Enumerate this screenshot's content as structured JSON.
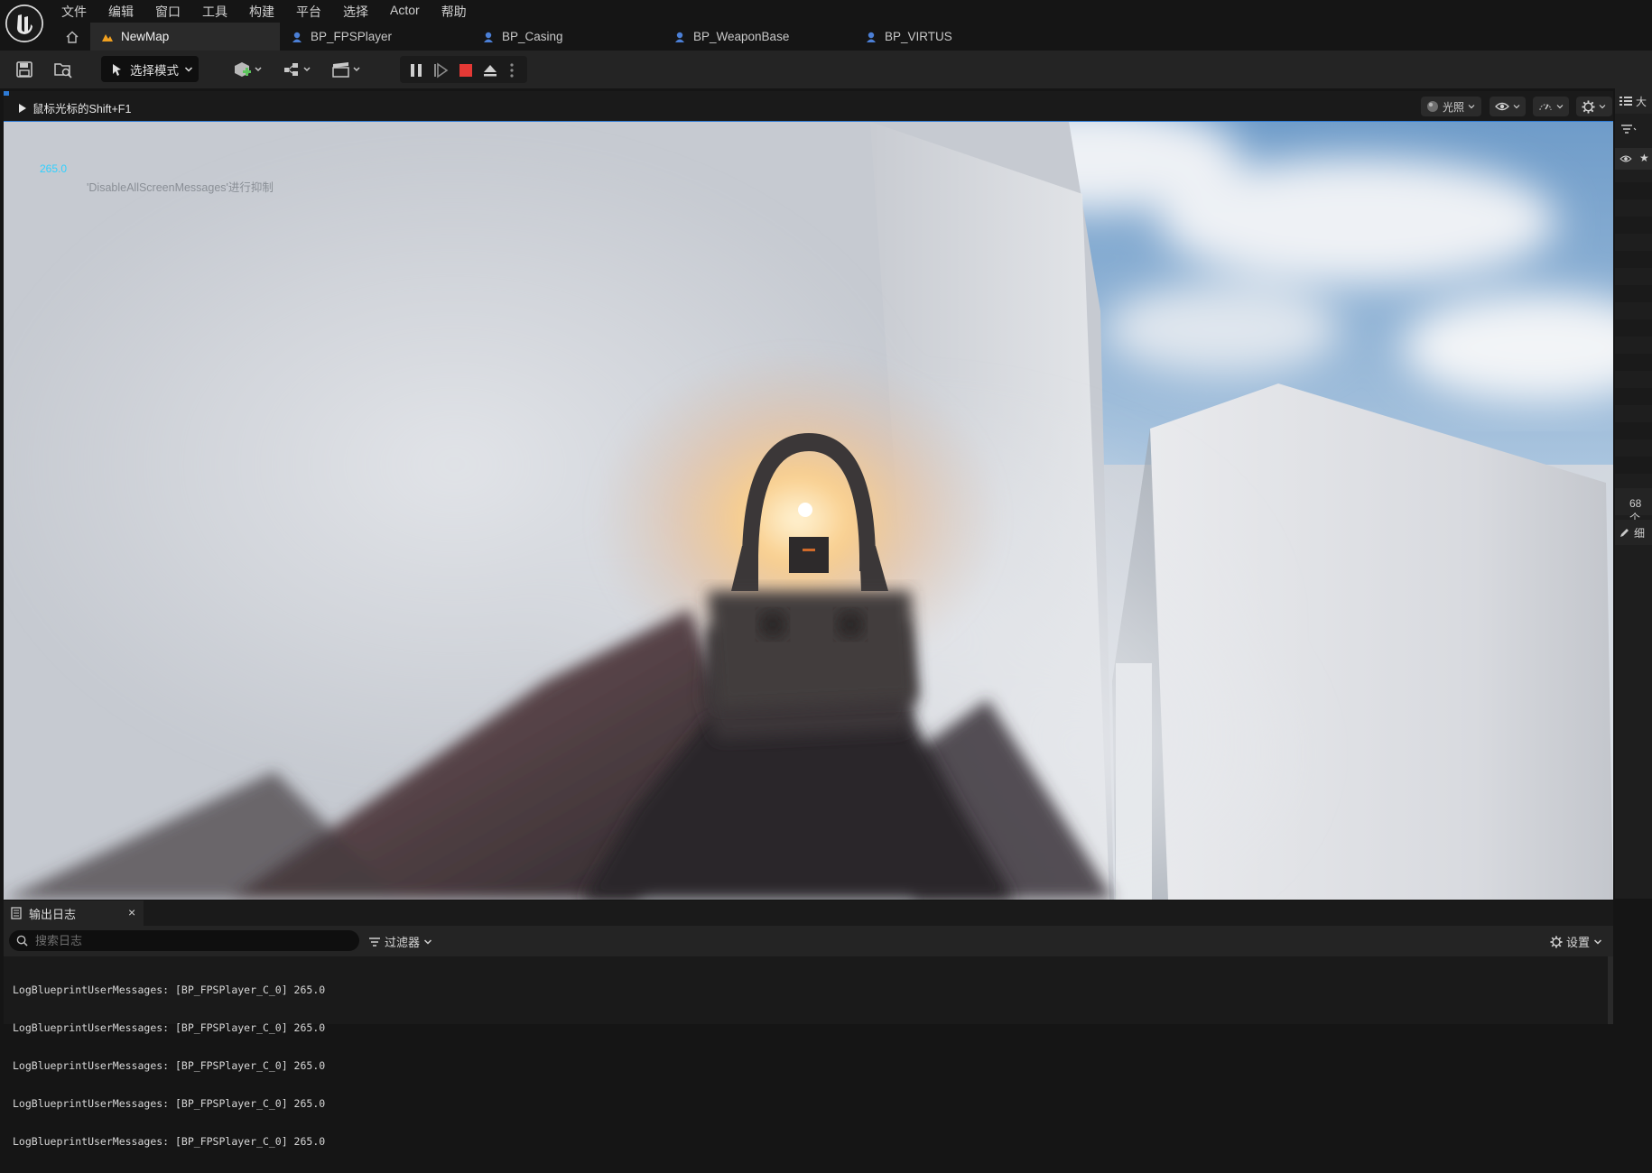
{
  "menu": [
    "文件",
    "编辑",
    "窗口",
    "工具",
    "构建",
    "平台",
    "选择",
    "Actor",
    "帮助"
  ],
  "tabs": [
    {
      "label": "NewMap",
      "icon": "level-icon",
      "active": true
    },
    {
      "label": "BP_FPSPlayer",
      "icon": "blueprint-icon",
      "active": false
    },
    {
      "label": "BP_Casing",
      "icon": "blueprint-icon",
      "active": false
    },
    {
      "label": "BP_WeaponBase",
      "icon": "blueprint-icon",
      "active": false
    },
    {
      "label": "BP_VIRTUS",
      "icon": "blueprint-icon",
      "active": false
    }
  ],
  "toolbar": {
    "mode_label": "选择模式",
    "icons": [
      "save-icon",
      "content-browser-icon",
      "add-actor-icon",
      "blueprint-menu-icon",
      "cinematics-icon",
      "pause-icon",
      "step-icon",
      "stop-icon",
      "eject-icon",
      "more-options-icon"
    ],
    "stop_color": "#e53935"
  },
  "viewport": {
    "hint_text": "鼠标光标的Shift+F1",
    "lighting_label": "光照",
    "fps_value": "265.0",
    "screen_message": "'DisableAllScreenMessages'进行抑制",
    "accent": "#2fd0ff"
  },
  "right_panel": {
    "count_text": "68个",
    "detail_char": "细",
    "outliner_char": "大"
  },
  "output_log": {
    "tab_label": "输出日志",
    "close_label": "×",
    "search_placeholder": "搜索日志",
    "filter_label": "过滤器",
    "settings_label": "设置",
    "lines": [
      "LogBlueprintUserMessages: [BP_FPSPlayer_C_0] 265.0",
      "LogBlueprintUserMessages: [BP_FPSPlayer_C_0] 265.0",
      "LogBlueprintUserMessages: [BP_FPSPlayer_C_0] 265.0",
      "LogBlueprintUserMessages: [BP_FPSPlayer_C_0] 265.0",
      "LogBlueprintUserMessages: [BP_FPSPlayer_C_0] 265.0"
    ]
  }
}
